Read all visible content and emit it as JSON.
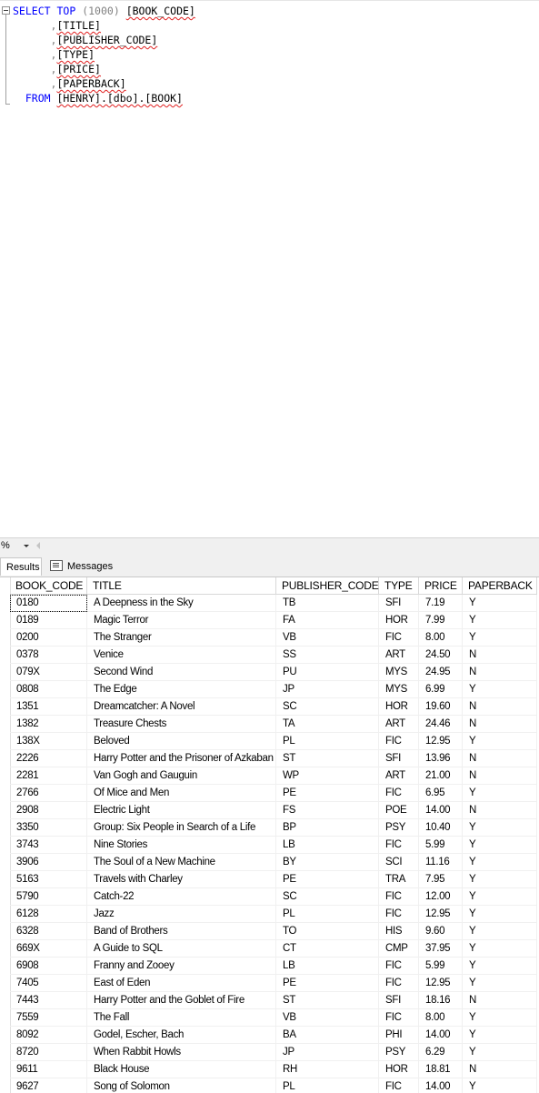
{
  "editor": {
    "line1": {
      "kw1": "SELECT",
      "kw2": "TOP",
      "num": "(1000)",
      "ident": "[BOOK_CODE]"
    },
    "columns": [
      "[TITLE]",
      "[PUBLISHER_CODE]",
      "[TYPE]",
      "[PRICE]",
      "[PAPERBACK]"
    ],
    "from_kw": "FROM",
    "from_ident": "[HENRY].[dbo].[BOOK]"
  },
  "zoom": {
    "value": "%"
  },
  "tabs": {
    "results": "Results",
    "messages": "Messages"
  },
  "grid": {
    "columns": [
      "BOOK_CODE",
      "TITLE",
      "PUBLISHER_CODE",
      "TYPE",
      "PRICE",
      "PAPERBACK"
    ],
    "rows": [
      [
        "0180",
        "A Deepness in the Sky",
        "TB",
        "SFI",
        "7.19",
        "Y"
      ],
      [
        "0189",
        "Magic Terror",
        "FA",
        "HOR",
        "7.99",
        "Y"
      ],
      [
        "0200",
        "The Stranger",
        "VB",
        "FIC",
        "8.00",
        "Y"
      ],
      [
        "0378",
        "Venice",
        "SS",
        "ART",
        "24.50",
        "N"
      ],
      [
        "079X",
        "Second Wind",
        "PU",
        "MYS",
        "24.95",
        "N"
      ],
      [
        "0808",
        "The Edge",
        "JP",
        "MYS",
        "6.99",
        "Y"
      ],
      [
        "1351",
        "Dreamcatcher: A Novel",
        "SC",
        "HOR",
        "19.60",
        "N"
      ],
      [
        "1382",
        "Treasure Chests",
        "TA",
        "ART",
        "24.46",
        "N"
      ],
      [
        "138X",
        "Beloved",
        "PL",
        "FIC",
        "12.95",
        "Y"
      ],
      [
        "2226",
        "Harry Potter and the Prisoner of Azkaban",
        "ST",
        "SFI",
        "13.96",
        "N"
      ],
      [
        "2281",
        "Van Gogh and Gauguin",
        "WP",
        "ART",
        "21.00",
        "N"
      ],
      [
        "2766",
        "Of Mice and Men",
        "PE",
        "FIC",
        "6.95",
        "Y"
      ],
      [
        "2908",
        "Electric Light",
        "FS",
        "POE",
        "14.00",
        "N"
      ],
      [
        "3350",
        "Group: Six People in Search of a Life",
        "BP",
        "PSY",
        "10.40",
        "Y"
      ],
      [
        "3743",
        "Nine Stories",
        "LB",
        "FIC",
        "5.99",
        "Y"
      ],
      [
        "3906",
        "The Soul of a New Machine",
        "BY",
        "SCI",
        "11.16",
        "Y"
      ],
      [
        "5163",
        "Travels with Charley",
        "PE",
        "TRA",
        "7.95",
        "Y"
      ],
      [
        "5790",
        "Catch-22",
        "SC",
        "FIC",
        "12.00",
        "Y"
      ],
      [
        "6128",
        "Jazz",
        "PL",
        "FIC",
        "12.95",
        "Y"
      ],
      [
        "6328",
        "Band of Brothers",
        "TO",
        "HIS",
        "9.60",
        "Y"
      ],
      [
        "669X",
        "A Guide to SQL",
        "CT",
        "CMP",
        "37.95",
        "Y"
      ],
      [
        "6908",
        "Franny and Zooey",
        "LB",
        "FIC",
        "5.99",
        "Y"
      ],
      [
        "7405",
        "East of Eden",
        "PE",
        "FIC",
        "12.95",
        "Y"
      ],
      [
        "7443",
        "Harry Potter and the Goblet of Fire",
        "ST",
        "SFI",
        "18.16",
        "N"
      ],
      [
        "7559",
        "The Fall",
        "VB",
        "FIC",
        "8.00",
        "Y"
      ],
      [
        "8092",
        "Godel, Escher, Bach",
        "BA",
        "PHI",
        "14.00",
        "Y"
      ],
      [
        "8720",
        "When Rabbit Howls",
        "JP",
        "PSY",
        "6.29",
        "Y"
      ],
      [
        "9611",
        "Black House",
        "RH",
        "HOR",
        "18.81",
        "N"
      ],
      [
        "9627",
        "Song of Solomon",
        "PL",
        "FIC",
        "14.00",
        "Y"
      ]
    ]
  }
}
